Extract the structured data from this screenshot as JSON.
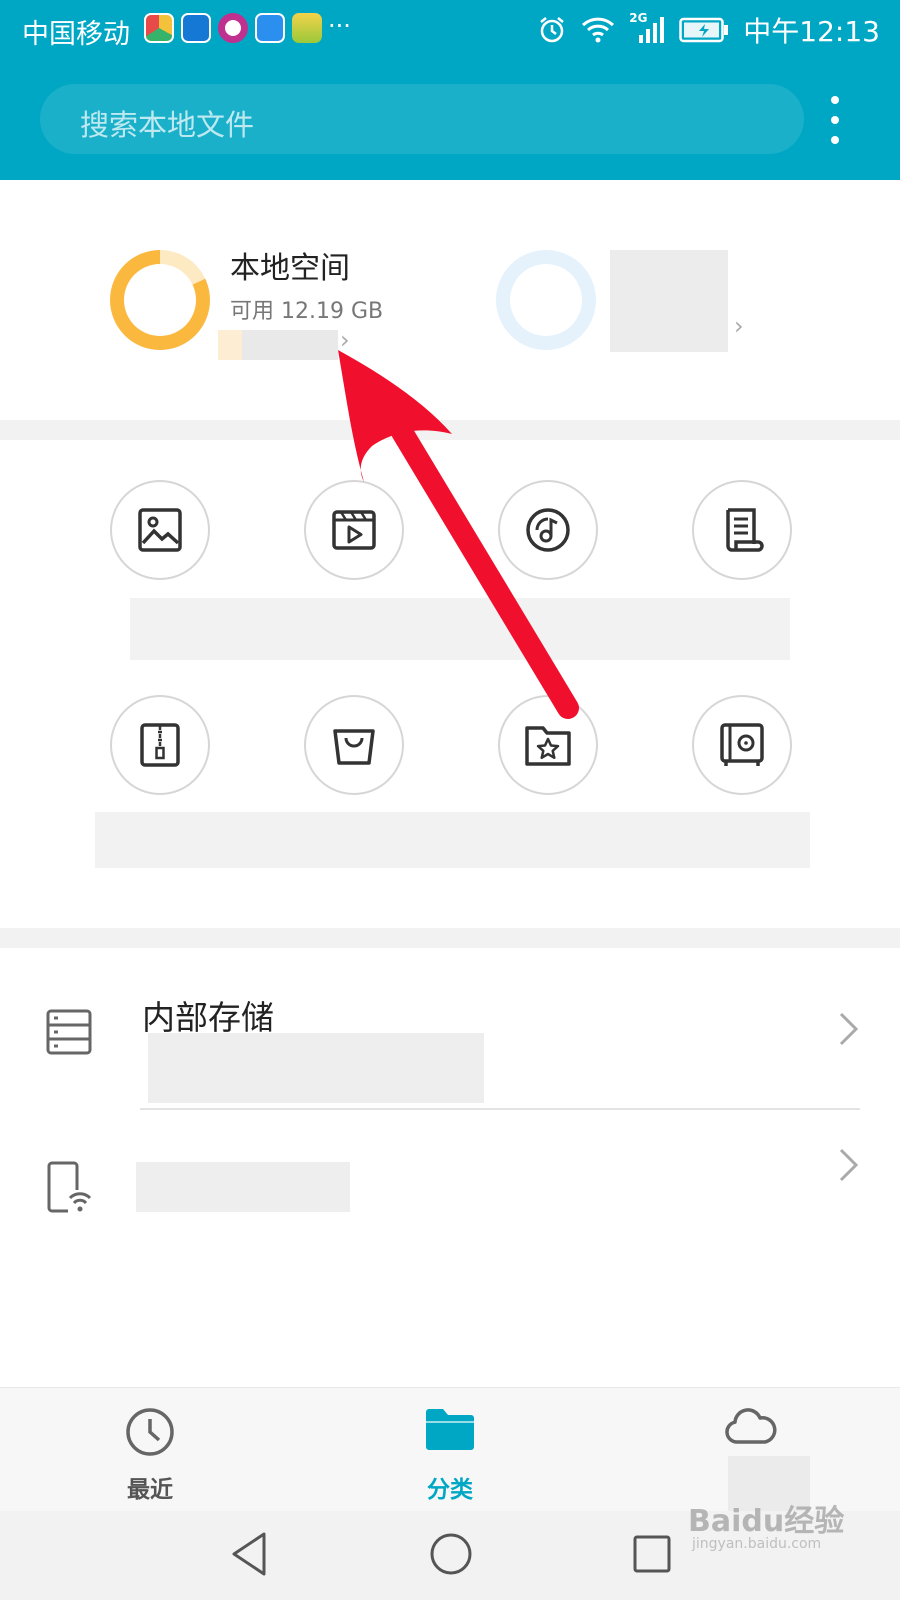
{
  "status_bar": {
    "carrier": "中国移动",
    "more": "···",
    "network": "2G",
    "time": "中午12:13"
  },
  "search": {
    "placeholder": "搜索本地文件"
  },
  "storage_summary": {
    "local_title": "本地空间",
    "local_available": "可用 12.19 GB",
    "used_fraction": 0.82
  },
  "categories": [
    {
      "name": "image",
      "icon": "image-icon"
    },
    {
      "name": "video",
      "icon": "video-icon"
    },
    {
      "name": "music",
      "icon": "music-icon"
    },
    {
      "name": "document",
      "icon": "document-icon"
    },
    {
      "name": "archive",
      "icon": "archive-icon"
    },
    {
      "name": "installation",
      "icon": "shopping-bag-icon"
    },
    {
      "name": "favorites",
      "icon": "star-folder-icon"
    },
    {
      "name": "safe",
      "icon": "safe-icon"
    }
  ],
  "storage_list": [
    {
      "title": "内部存储",
      "icon": "storage-icon"
    },
    {
      "title": "",
      "icon": "phone-wifi-icon"
    }
  ],
  "bottom_nav": {
    "recent": "最近",
    "categories": "分类",
    "active": "分类"
  },
  "watermark": {
    "brand": "Baidu经验",
    "url": "jingyan.baidu.com"
  },
  "colors": {
    "header": "#00A7C4",
    "accent": "#00A7C4",
    "storage_ring": "#FBB83F",
    "annotation_arrow": "#F0102E"
  }
}
